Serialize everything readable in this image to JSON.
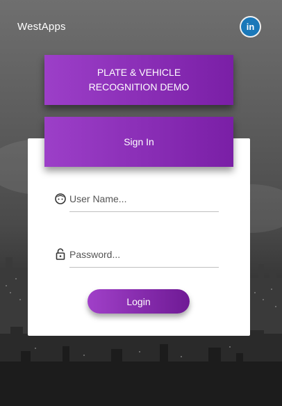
{
  "app": {
    "brand": "WestApps"
  },
  "social": {
    "linkedin_label": "in"
  },
  "banner": {
    "line1": "PLATE & VEHICLE",
    "line2": "RECOGNITION DEMO"
  },
  "signin": {
    "title": "Sign In"
  },
  "form": {
    "username": {
      "placeholder": "User Name...",
      "value": ""
    },
    "password": {
      "placeholder": "Password...",
      "value": ""
    },
    "login_label": "Login"
  },
  "colors": {
    "accent_start": "#9c3fc8",
    "accent_end": "#7a1fa6",
    "linkedin": "#1a78b9"
  }
}
